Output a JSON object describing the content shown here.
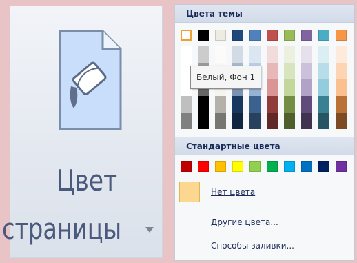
{
  "ribbon_button": {
    "label_line1": "Цвет",
    "label_line2": "страницы",
    "icon": "page-paint-bucket-icon",
    "dropdown_icon": "dropdown-arrow-icon"
  },
  "palette": {
    "theme_header": "Цвета темы",
    "theme_colors": [
      "#ffffff",
      "#000000",
      "#eeece1",
      "#1f497d",
      "#4f81bd",
      "#c0504d",
      "#9bbb59",
      "#8064a2",
      "#4bacc6",
      "#f79646"
    ],
    "tooltip": "Белый, Фон 1",
    "standard_header": "Стандартные цвета",
    "standard_colors": [
      "#c00000",
      "#ff0000",
      "#ffc000",
      "#ffff00",
      "#92d050",
      "#00b050",
      "#00b0f0",
      "#0070c0",
      "#002060",
      "#7030a0"
    ],
    "no_color_label": "Нет цвета",
    "more_colors_label": "Другие цвета...",
    "fill_effects_label": "Способы заливки..."
  }
}
